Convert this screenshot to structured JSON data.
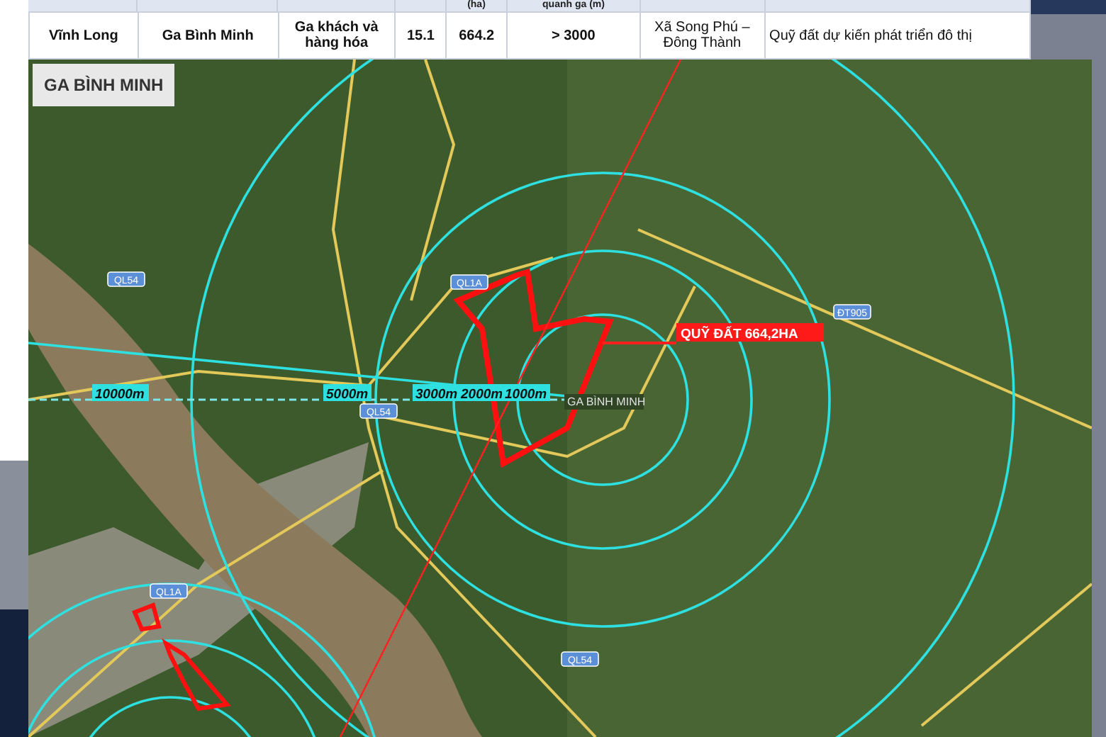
{
  "table": {
    "header_row": [
      "(ha)",
      "quanh ga (m)"
    ],
    "row": [
      "Vĩnh Long",
      "Ga Bình Minh",
      "Ga khách và hàng hóa",
      "15.1",
      "664.2",
      "> 3000",
      "Xã Song Phú – Đông Thành",
      "Quỹ đất dự kiến phát triển đô thị"
    ]
  },
  "map": {
    "title": "GA BÌNH MINH",
    "station_label": "GA BÌNH MINH",
    "land_label": "QUỸ ĐẤT 664,2HA",
    "distance_labels": [
      "10000m",
      "5000m",
      "3000m",
      "2000m",
      "1000m"
    ],
    "road_markers": [
      "QL54",
      "QL1A",
      "QL54",
      "ĐT905",
      "QL1A",
      "QL54"
    ]
  }
}
